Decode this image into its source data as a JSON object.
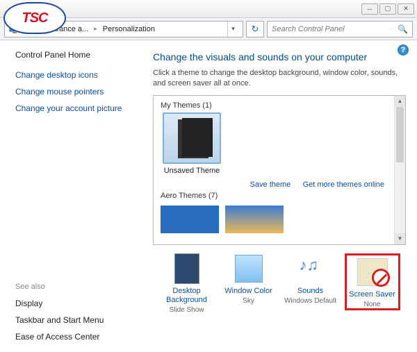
{
  "breadcrumb": {
    "level1": "Appearance a...",
    "level2": "Personalization"
  },
  "search": {
    "placeholder": "Search Control Panel"
  },
  "sidebar": {
    "home": "Control Panel Home",
    "links": [
      "Change desktop icons",
      "Change mouse pointers",
      "Change your account picture"
    ],
    "see_also_label": "See also",
    "see_also": [
      "Display",
      "Taskbar and Start Menu",
      "Ease of Access Center"
    ]
  },
  "heading": "Change the visuals and sounds on your computer",
  "subtext": "Click a theme to change the desktop background, window color, sounds, and screen saver all at once.",
  "themes": {
    "my_themes_label": "My Themes (1)",
    "unsaved_label": "Unsaved Theme",
    "save_link": "Save theme",
    "more_link": "Get more themes online",
    "aero_label": "Aero Themes (7)"
  },
  "bottom": {
    "desktop_bg": {
      "label": "Desktop Background",
      "sub": "Slide Show"
    },
    "window_color": {
      "label": "Window Color",
      "sub": "Sky"
    },
    "sounds": {
      "label": "Sounds",
      "sub": "Windows Default"
    },
    "screensaver": {
      "label": "Screen Saver",
      "sub": "None"
    }
  },
  "logo": {
    "text": "TSC"
  }
}
